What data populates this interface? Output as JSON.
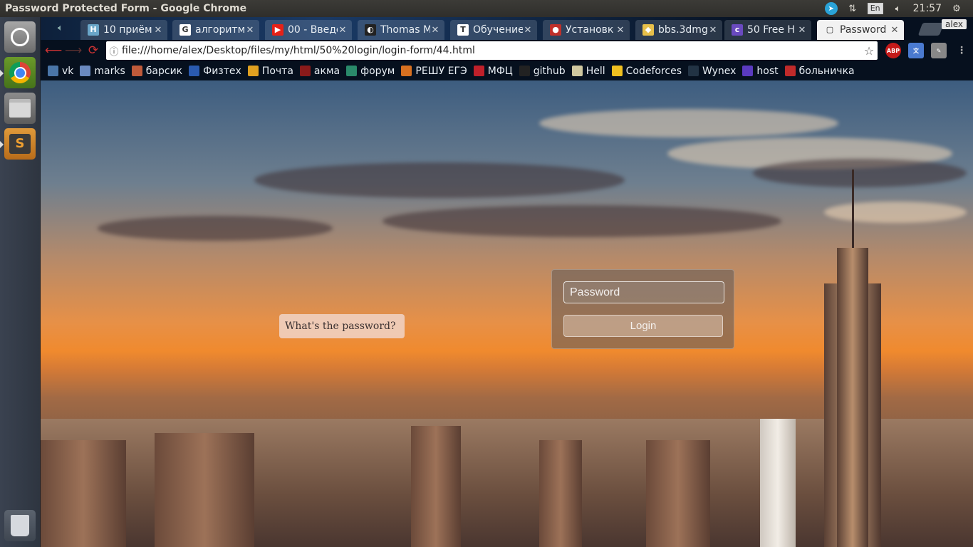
{
  "window": {
    "title": "Password Protected Form - Google Chrome",
    "tray": {
      "lang": "En",
      "clock": "21:57",
      "icons": [
        "telegram-icon",
        "network-icon",
        "volume-icon",
        "gear-icon"
      ]
    }
  },
  "launcher": {
    "items": [
      "dash-home-icon",
      "chrome-icon",
      "files-icon",
      "sublime-text-icon",
      "trash-icon"
    ]
  },
  "tabs": [
    {
      "label": "10 приём",
      "fav": "H",
      "favbg": "#6aa6c8"
    },
    {
      "label": "алгоритм",
      "fav": "G",
      "favbg": "#ffffff"
    },
    {
      "label": "00 - Введе",
      "fav": "▶",
      "favbg": "#e62117"
    },
    {
      "label": "Thomas M",
      "fav": "◐",
      "favbg": "#222222"
    },
    {
      "label": "Обучение",
      "fav": "T",
      "favbg": "#ffffff"
    },
    {
      "label": "Установк",
      "fav": "●",
      "favbg": "#c0302a"
    },
    {
      "label": "bbs.3dmg",
      "fav": "◆",
      "favbg": "#e8c04a"
    },
    {
      "label": "50 Free H",
      "fav": "c",
      "favbg": "#6a4ac0"
    },
    {
      "label": "Password",
      "fav": "▢",
      "favbg": "#f2f2f2"
    }
  ],
  "profile": "alex",
  "toolbar": {
    "url": "file:///home/alex/Desktop/files/my/html/50%20login/login-form/44.html",
    "ext": [
      "ABP"
    ]
  },
  "bookmarks": [
    {
      "label": "vk",
      "color": "#4a76a8"
    },
    {
      "label": "marks",
      "color": "#6a8ac0"
    },
    {
      "label": "барсик",
      "color": "#c05a3a"
    },
    {
      "label": "Физтех",
      "color": "#2a5ab0"
    },
    {
      "label": "Почта",
      "color": "#e0a020"
    },
    {
      "label": "акма",
      "color": "#8a1a1a"
    },
    {
      "label": "форум",
      "color": "#2a8a6a"
    },
    {
      "label": "РЕШУ ЕГЭ",
      "color": "#d87020"
    },
    {
      "label": "МФЦ",
      "color": "#c0202a"
    },
    {
      "label": "github",
      "color": "#222222"
    },
    {
      "label": "Hell",
      "color": "#d0c8a0"
    },
    {
      "label": "Codeforces",
      "color": "#f0c020"
    },
    {
      "label": "Wynex",
      "color": "#223344"
    },
    {
      "label": "host",
      "color": "#5a3ac0"
    },
    {
      "label": "больничка",
      "color": "#c02a2a"
    }
  ],
  "page": {
    "hint": "What's the password?",
    "password_placeholder": "Password",
    "login_label": "Login"
  }
}
